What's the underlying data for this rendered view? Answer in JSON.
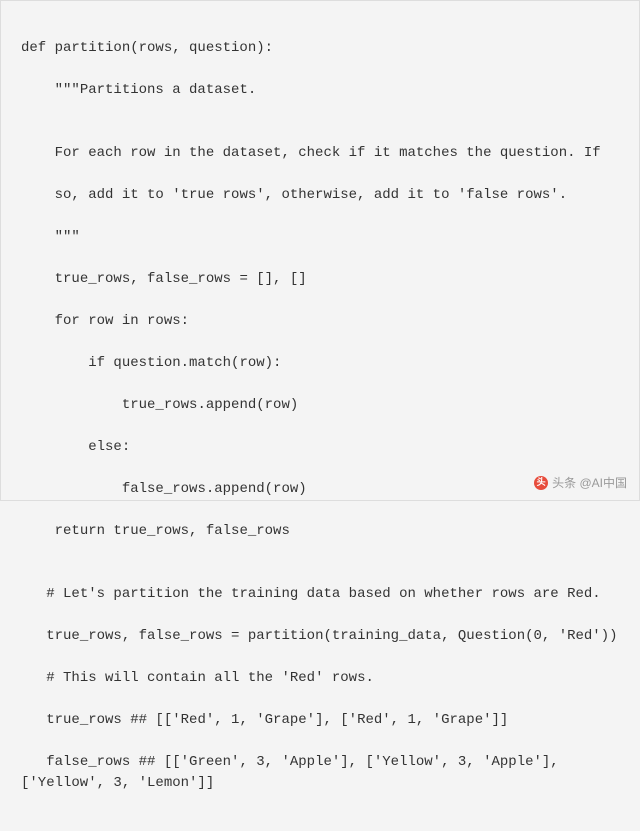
{
  "code": {
    "l1": "def partition(rows, question):",
    "l2": "    \"\"\"Partitions a dataset.",
    "l3": "",
    "l4": "    For each row in the dataset, check if it matches the question. If",
    "l5": "    so, add it to 'true rows', otherwise, add it to 'false rows'.",
    "l6": "    \"\"\"",
    "l7": "    true_rows, false_rows = [], []",
    "l8": "    for row in rows:",
    "l9": "        if question.match(row):",
    "l10": "            true_rows.append(row)",
    "l11": "        else:",
    "l12": "            false_rows.append(row)",
    "l13": "    return true_rows, false_rows",
    "l14": "",
    "l15": "   # Let's partition the training data based on whether rows are Red.",
    "l16": "   true_rows, false_rows = partition(training_data, Question(0, 'Red'))",
    "l17": "   # This will contain all the 'Red' rows.",
    "l18": "   true_rows ## [['Red', 1, 'Grape'], ['Red', 1, 'Grape']]",
    "l19": "   false_rows ## [['Green', 3, 'Apple'], ['Yellow', 3, 'Apple'], ['Yellow', 3, 'Lemon']]"
  },
  "watermark": {
    "text": "头条 @AI中国"
  }
}
